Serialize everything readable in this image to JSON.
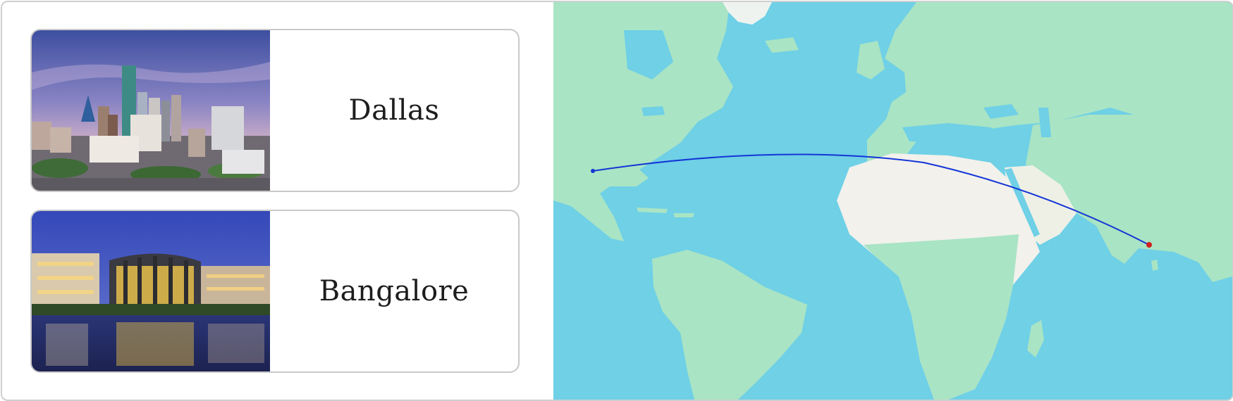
{
  "cities": [
    {
      "name": "Dallas",
      "photo": "dallas-skyline-photo"
    },
    {
      "name": "Bangalore",
      "photo": "bangalore-waterfront-photo"
    }
  ],
  "map": {
    "colors": {
      "ocean": "#6fd0e6",
      "land": "#a9e4c4",
      "desert": "#f2f1ec",
      "route": "#1436d6",
      "marker": "#d01f1f"
    }
  }
}
